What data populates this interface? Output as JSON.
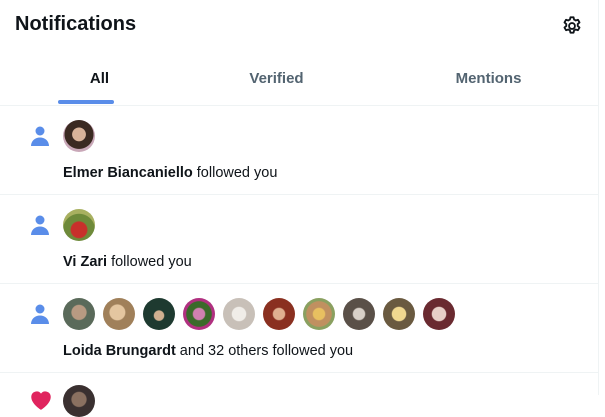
{
  "header": {
    "title": "Notifications",
    "settings_icon": "gear-icon"
  },
  "tabs": [
    {
      "label": "All",
      "active": true
    },
    {
      "label": "Verified",
      "active": false
    },
    {
      "label": "Mentions",
      "active": false
    }
  ],
  "notifications": [
    {
      "icon": "person-icon",
      "name": "Elmer Biancaniello",
      "action": " followed you"
    },
    {
      "icon": "person-icon",
      "name": "Vi Zari",
      "action": " followed you"
    },
    {
      "icon": "person-icon",
      "name": "Loida Brungardt",
      "action": " and 32 others followed you"
    },
    {
      "icon": "heart-icon"
    }
  ],
  "colors": {
    "accent": "#5a8de9",
    "heart": "#e0245e",
    "border": "#eff3f4",
    "muted": "#536471"
  }
}
